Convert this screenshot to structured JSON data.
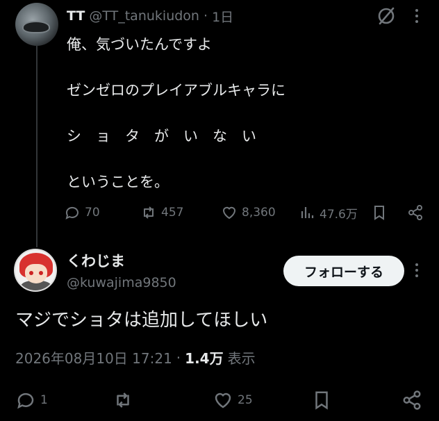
{
  "original_tweet": {
    "display_name": "TT",
    "handle": "@TT_tanukiudon",
    "time": "1日",
    "lines": [
      "俺、気づいたんですよ",
      "ゼンゼロのプレイアブルキャラに",
      "シ　ョ　タ　が　い　な　い",
      "ということを。"
    ],
    "replies": "70",
    "reposts": "457",
    "likes": "8,360",
    "views": "47.6万"
  },
  "reply_tweet": {
    "display_name": "くわじま",
    "handle": "@kuwajima9850",
    "follow_label": "フォローする",
    "text": "マジでショタは追加してほしい",
    "timestamp": "2026年08月10日 17:21",
    "separator": "·",
    "views": "1.4万",
    "views_label": "表示",
    "replies": "1",
    "likes": "25"
  },
  "icons": {
    "grok": "grok-icon",
    "more": "more-vertical-icon",
    "reply": "reply-icon",
    "repost": "repost-icon",
    "like": "heart-icon",
    "views": "views-chart-icon",
    "bookmark": "bookmark-icon",
    "share": "share-icon"
  },
  "colors": {
    "background": "#000000",
    "text": "#e7e9ea",
    "muted": "#71767b",
    "follow_bg": "#eff3f4"
  }
}
